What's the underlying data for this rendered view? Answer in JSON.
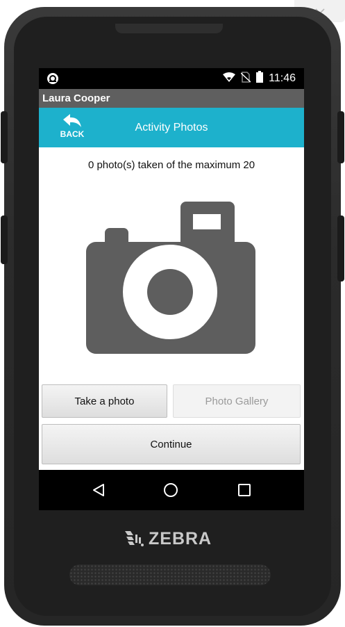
{
  "status_bar": {
    "time": "11:46"
  },
  "user": {
    "name": "Laura Cooper"
  },
  "header": {
    "back_label": "BACK",
    "title": "Activity Photos"
  },
  "photos": {
    "status_text": "0 photo(s) taken of the maximum 20"
  },
  "buttons": {
    "take_photo": "Take a photo",
    "photo_gallery": "Photo Gallery",
    "continue": "Continue"
  },
  "device": {
    "brand": "ZEBRA"
  },
  "colors": {
    "accent": "#1db1cc",
    "user_bar": "#5f5f5f",
    "camera_icon": "#5e5e5e",
    "disabled_text": "#9a9a9a"
  }
}
